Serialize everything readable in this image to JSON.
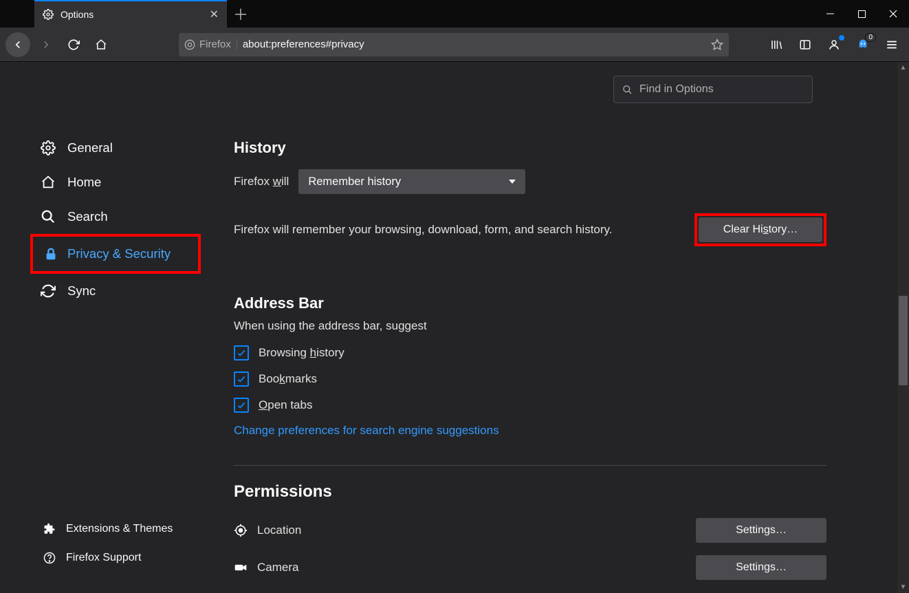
{
  "tab": {
    "title": "Options"
  },
  "urlbar": {
    "identity": "Firefox",
    "url": "about:preferences#privacy"
  },
  "toolbar": {
    "ghost_badge": "0"
  },
  "search": {
    "placeholder": "Find in Options"
  },
  "sidebar": {
    "items": [
      {
        "label": "General"
      },
      {
        "label": "Home"
      },
      {
        "label": "Search"
      },
      {
        "label": "Privacy & Security"
      },
      {
        "label": "Sync"
      }
    ],
    "footer": [
      {
        "label": "Extensions & Themes"
      },
      {
        "label": "Firefox Support"
      }
    ]
  },
  "history": {
    "title": "History",
    "firefox_will_pre": "Firefox ",
    "firefox_will_u": "w",
    "firefox_will_post": "ill",
    "dropdown_value": "Remember history",
    "description": "Firefox will remember your browsing, download, form, and search history.",
    "clear_pre": "Clear Hi",
    "clear_u": "s",
    "clear_post": "tory…"
  },
  "address_bar": {
    "title": "Address Bar",
    "subtext": "When using the address bar, suggest",
    "cb1_pre": "Browsing ",
    "cb1_u": "h",
    "cb1_post": "istory",
    "cb2_pre": "Boo",
    "cb2_u": "k",
    "cb2_post": "marks",
    "cb3_u": "O",
    "cb3_post": "pen tabs",
    "link": "Change preferences for search engine suggestions"
  },
  "permissions": {
    "title": "Permissions",
    "location": "Location",
    "camera": "Camera",
    "settings": "Settings…"
  }
}
